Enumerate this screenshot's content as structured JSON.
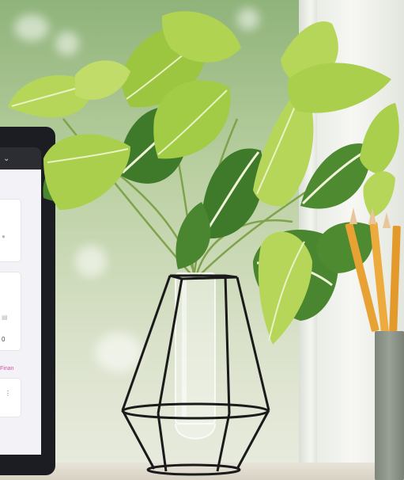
{
  "scene": {
    "laptop": {
      "chevron_icon": "chevron-down",
      "card_value_1": "0",
      "pink_label": "Finan",
      "ellipsis": "⋮"
    },
    "colors": {
      "leaf_light": "#b6d65a",
      "leaf_mid": "#8fbf3a",
      "leaf_dark": "#3f7a2b",
      "vein": "#f1f5d7",
      "frame_black": "#1a1a1a",
      "pencil": "#e7a233",
      "cup": "#8a9187",
      "accent_pink": "#d94fa0"
    }
  }
}
